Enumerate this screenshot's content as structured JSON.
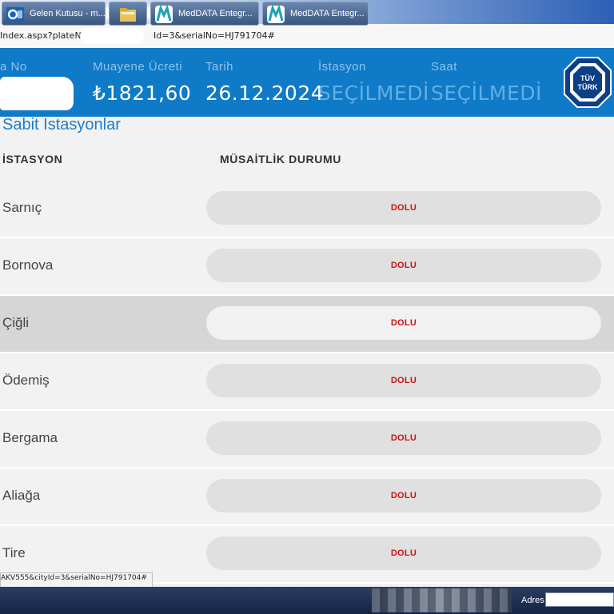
{
  "browser": {
    "url_start": "Index.aspx?plateN",
    "url_end": "Id=3&serialNo=HJ791704#"
  },
  "header": {
    "plate_label": "a No",
    "fee_label": "Muayene Ücreti",
    "fee_value": "₺1821,60",
    "date_label": "Tarih",
    "date_value": "26.12.2024",
    "station_label": "İstasyon",
    "station_value": "SEÇİLMEDİ",
    "time_label": "Saat",
    "time_value": "SEÇİLMEDİ",
    "logo_line1": "TÜV",
    "logo_line2": "TÜRK"
  },
  "section": {
    "title": "Sabit İstasyonlar"
  },
  "table": {
    "col_station": "İSTASYON",
    "col_status": "MÜSAİTLİK DURUMU",
    "rows": [
      {
        "name": "Sarnıç",
        "status": "DOLU"
      },
      {
        "name": "Bornova",
        "status": "DOLU"
      },
      {
        "name": "Çiğli",
        "status": "DOLU"
      },
      {
        "name": "Ödemiş",
        "status": "DOLU"
      },
      {
        "name": "Bergama",
        "status": "DOLU"
      },
      {
        "name": "Aliağa",
        "status": "DOLU"
      },
      {
        "name": "Tire",
        "status": "DOLU"
      }
    ]
  },
  "statusbar": {
    "link_url": "AKV555&cityId=3&serialNo=HJ791704#"
  },
  "taskbar": {
    "task1": "Gelen Kutusu - m...",
    "task3": "MedDATA Entegr...",
    "task4": "MedDATA Entegr...",
    "adres_label": "Adres",
    "adres_value": ""
  },
  "colors": {
    "header_blue": "#0f7ac7",
    "status_red": "#cc1111",
    "title_blue": "#1c7dc8"
  }
}
